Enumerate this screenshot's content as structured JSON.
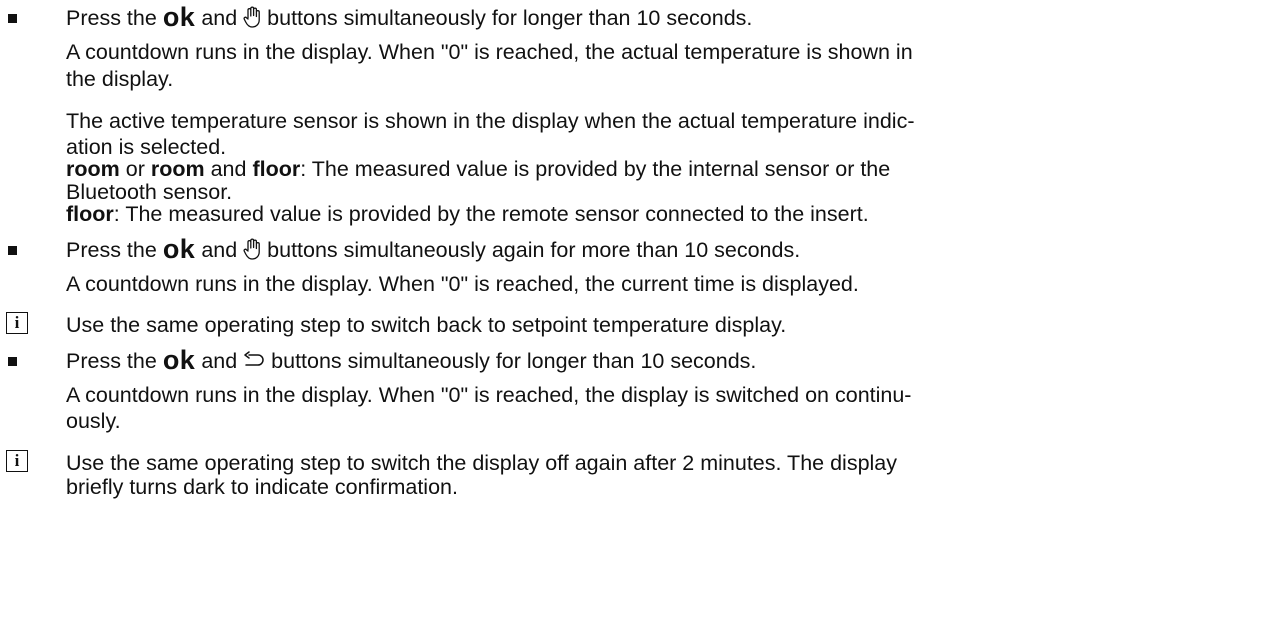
{
  "icons": {
    "bullet": "bullet-square",
    "info": "info-box-icon",
    "hand": "hand-icon",
    "back": "back-arrow-icon"
  },
  "info_letter": "i",
  "ok_key": "ok",
  "l00_pre": "Press the",
  "l00_and": "and",
  "l00_post": "buttons simultaneously for longer than 10 seconds.",
  "l01": "A countdown runs in the display. When \"0\" is reached, the actual temperature is shown in",
  "l02": "the display.",
  "l03": "The active temperature sensor is shown in the display when the actual temperature indic-",
  "l04": "ation is selected.",
  "l05_room1": "room",
  "l05_or": "or",
  "l05_room2": "room",
  "l05_and": "and",
  "l05_floor": "floor",
  "l05_post": ": The measured value is provided by the internal sensor or the",
  "l06": "Bluetooth sensor.",
  "l07_floor": "floor",
  "l07_post": ": The measured value is provided by the remote sensor connected to the insert.",
  "l08_pre": "Press the",
  "l08_and": "and",
  "l08_post": "buttons simultaneously again for more than 10 seconds.",
  "l09": "A countdown runs in the display. When \"0\" is reached, the current time is displayed.",
  "l10": "Use the same operating step to switch back to setpoint temperature display.",
  "l11_pre": "Press the",
  "l11_and": "and",
  "l11_post": "buttons simultaneously for longer than 10 seconds.",
  "l12": "A countdown runs in the display. When \"0\" is reached, the display is switched on continu-",
  "l13": "ously.",
  "l14": "Use the same operating step to switch the display off again after 2 minutes. The display",
  "l15": "briefly turns dark to indicate confirmation."
}
